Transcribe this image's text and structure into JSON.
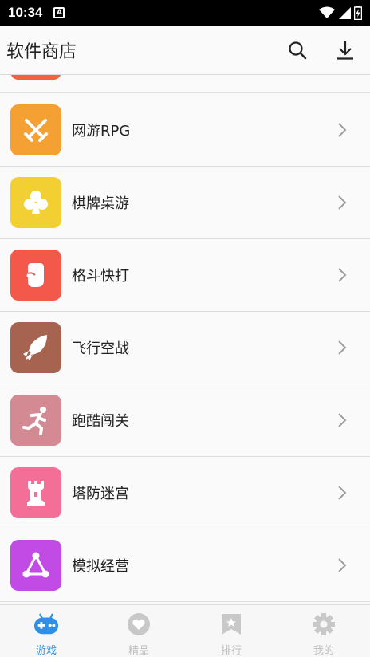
{
  "status_bar": {
    "time": "10:34",
    "a_badge": "A"
  },
  "app_bar": {
    "title": "软件商店",
    "search_icon": "search-icon",
    "download_icon": "download-icon"
  },
  "list": {
    "items": [
      {
        "label": "网游RPG",
        "icon": "crossed-swords-icon",
        "color": "#f4a033"
      },
      {
        "label": "棋牌桌游",
        "icon": "club-icon",
        "color": "#f2cf33"
      },
      {
        "label": "格斗快打",
        "icon": "fist-icon",
        "color": "#f4584a"
      },
      {
        "label": "飞行空战",
        "icon": "rocket-icon",
        "color": "#a6634f"
      },
      {
        "label": "跑酷闯关",
        "icon": "runner-icon",
        "color": "#d38a93"
      },
      {
        "label": "塔防迷宫",
        "icon": "tower-icon",
        "color": "#f36f98"
      },
      {
        "label": "模拟经营",
        "icon": "triangle-network-icon",
        "color": "#c14be4"
      }
    ],
    "partial_top_color": "#f2623e"
  },
  "tab_bar": {
    "tabs": [
      {
        "label": "游戏",
        "icon": "gamepad-icon",
        "active": true
      },
      {
        "label": "精品",
        "icon": "heart-icon",
        "active": false
      },
      {
        "label": "排行",
        "icon": "ranking-bookmark-icon",
        "active": false
      },
      {
        "label": "我的",
        "icon": "gear-icon",
        "active": false
      }
    ]
  },
  "colors": {
    "accent": "#2f8ee5",
    "inactive": "#bdbdbd"
  }
}
